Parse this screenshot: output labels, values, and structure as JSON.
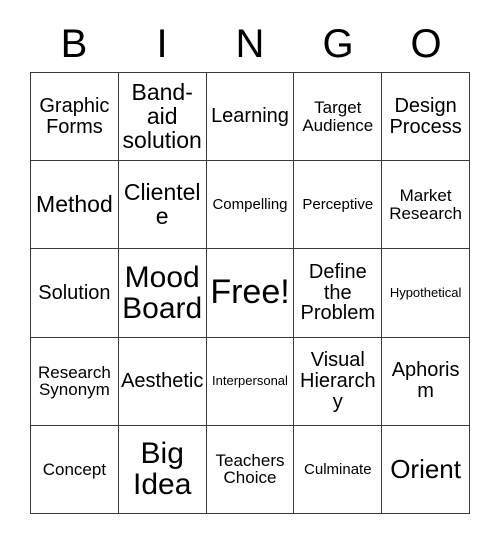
{
  "card": {
    "title_letters": [
      "B",
      "I",
      "N",
      "G",
      "O"
    ],
    "grid": {
      "rows": 5,
      "columns": 5,
      "border_color": "#3a3a3a",
      "background_color": "#ffffff",
      "text_color": "#000000"
    },
    "cells": [
      {
        "text": "Graphic Forms",
        "size": "fs-lg",
        "free": false
      },
      {
        "text": "Band-aid solution",
        "size": "fs-xl",
        "free": false
      },
      {
        "text": "Learning",
        "size": "fs-lg",
        "free": false
      },
      {
        "text": "Target Audience",
        "size": "fs-md",
        "free": false
      },
      {
        "text": "Design Process",
        "size": "fs-lg",
        "free": false
      },
      {
        "text": "Method",
        "size": "fs-xl",
        "free": false
      },
      {
        "text": "Clientele",
        "size": "fs-xl",
        "free": false
      },
      {
        "text": "Compelling",
        "size": "fs-sm",
        "free": false
      },
      {
        "text": "Perceptive",
        "size": "fs-sm",
        "free": false
      },
      {
        "text": "Market Research",
        "size": "fs-md",
        "free": false
      },
      {
        "text": "Solution",
        "size": "fs-lg",
        "free": false
      },
      {
        "text": "Mood Board",
        "size": "fs-3xl",
        "free": false
      },
      {
        "text": "Free!",
        "size": "fs-4xl",
        "free": true
      },
      {
        "text": "Define the Problem",
        "size": "fs-lg",
        "free": false
      },
      {
        "text": "Hypothetical",
        "size": "fs-xs",
        "free": false
      },
      {
        "text": "Research Synonym",
        "size": "fs-md",
        "free": false
      },
      {
        "text": "Aesthetic",
        "size": "fs-lg",
        "free": false
      },
      {
        "text": "Interpersonal",
        "size": "fs-xs",
        "free": false
      },
      {
        "text": "Visual Hierarchy",
        "size": "fs-lg",
        "free": false
      },
      {
        "text": "Aphorism",
        "size": "fs-lg",
        "free": false
      },
      {
        "text": "Concept",
        "size": "fs-md",
        "free": false
      },
      {
        "text": "Big Idea",
        "size": "fs-3xl",
        "free": false
      },
      {
        "text": "Teachers Choice",
        "size": "fs-md",
        "free": false
      },
      {
        "text": "Culminate",
        "size": "fs-sm",
        "free": false
      },
      {
        "text": "Orient",
        "size": "fs-2xl",
        "free": false
      }
    ]
  }
}
